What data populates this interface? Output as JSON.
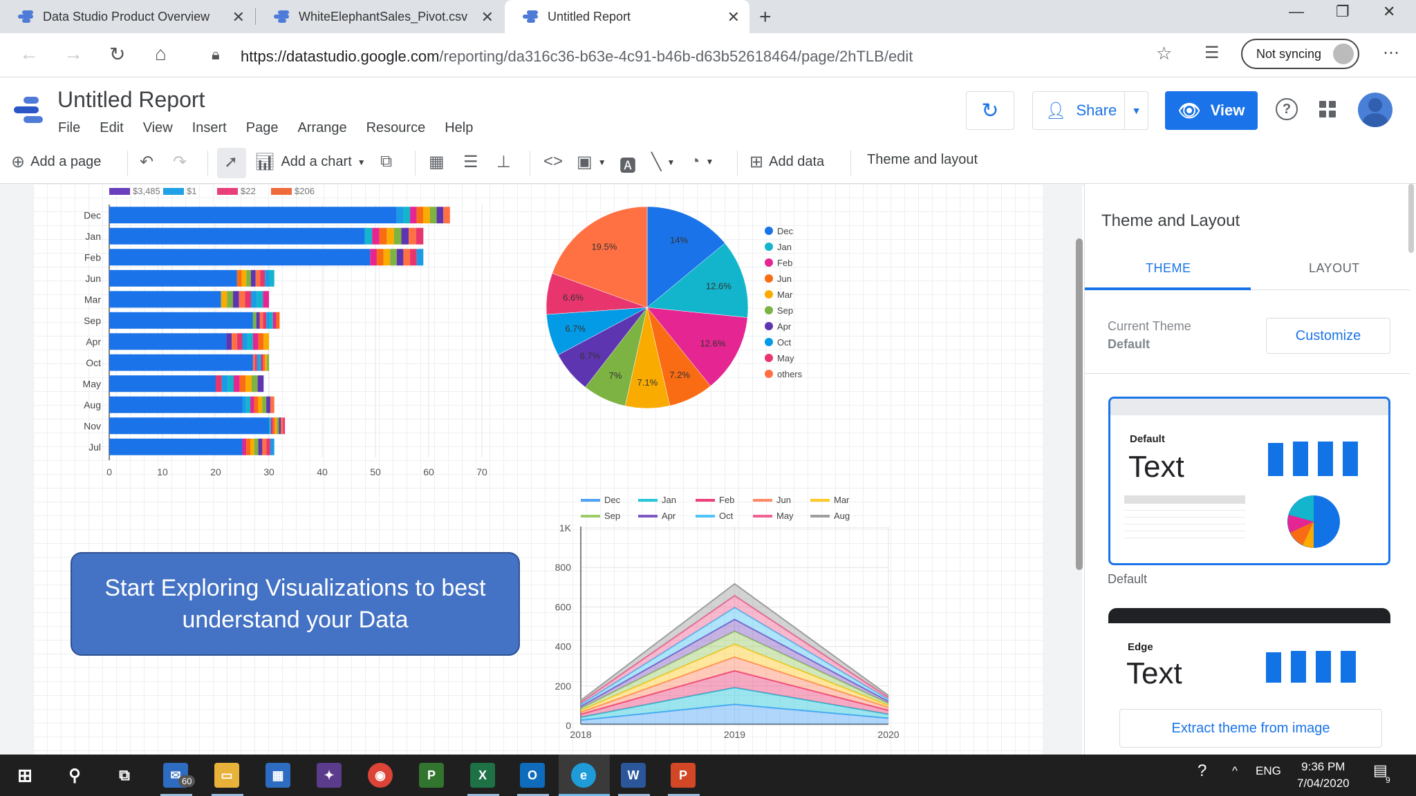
{
  "browser": {
    "tabs": [
      {
        "title": "Data Studio Product Overview",
        "active": false
      },
      {
        "title": "WhiteElephantSales_Pivot.csv",
        "active": false
      },
      {
        "title": "Untitled Report",
        "active": true
      }
    ],
    "url_host": "https://datastudio.google.com",
    "url_path": "/reporting/da316c36-b63e-4c91-b46b-d63b52618464/page/2hTLB/edit",
    "sync_label": "Not syncing"
  },
  "app": {
    "title": "Untitled Report",
    "menu": [
      "File",
      "Edit",
      "View",
      "Insert",
      "Page",
      "Arrange",
      "Resource",
      "Help"
    ],
    "share_label": "Share",
    "view_label": "View"
  },
  "toolbar": {
    "add_page": "Add a page",
    "add_chart": "Add a chart",
    "add_data": "Add data",
    "theme_layout": "Theme and layout"
  },
  "bar_chart": {
    "legend": [
      "$3,485",
      "$1",
      "$22",
      "$206"
    ],
    "legend_colors": [
      "#6a3fbd",
      "#1ea1e6",
      "#e8407a",
      "#f06b3c"
    ],
    "xticks": [
      "0",
      "10",
      "20",
      "30",
      "40",
      "50",
      "60",
      "70"
    ]
  },
  "pie_chart": {
    "legend": [
      "Dec",
      "Jan",
      "Feb",
      "Jun",
      "Mar",
      "Sep",
      "Apr",
      "Oct",
      "May",
      "others"
    ],
    "labels": [
      "14%",
      "12.6%",
      "12.6%",
      "7.2%",
      "7.1%",
      "7%",
      "6.7%",
      "6.7%",
      "6.6%",
      "19.5%"
    ]
  },
  "area_chart": {
    "legend": [
      "Dec",
      "Jan",
      "Feb",
      "Jun",
      "Mar",
      "Sep",
      "Apr",
      "Oct",
      "May",
      "Aug"
    ],
    "yticks": [
      "1K",
      "800",
      "600",
      "400",
      "200",
      "0"
    ],
    "xticks": [
      "2018",
      "2019",
      "2020"
    ]
  },
  "chart_data": [
    {
      "type": "bar",
      "orientation": "horizontal",
      "stacked": true,
      "categories": [
        "Dec",
        "Jan",
        "Feb",
        "Jun",
        "Mar",
        "Sep",
        "Apr",
        "Oct",
        "May",
        "Aug",
        "Nov",
        "Jul"
      ],
      "series": [
        {
          "values": [
            54,
            48,
            49,
            24,
            21,
            27,
            22,
            27,
            20,
            25,
            30,
            25
          ]
        }
      ],
      "totals": [
        64,
        59,
        59,
        31,
        30,
        32,
        30,
        30,
        29,
        31,
        33,
        31
      ],
      "xlim": [
        0,
        70
      ],
      "legend": [
        "$3,485",
        "$1",
        "$22",
        "$206"
      ]
    },
    {
      "type": "pie",
      "labels": [
        "Dec",
        "Jan",
        "Feb",
        "Jun",
        "Mar",
        "Sep",
        "Apr",
        "Oct",
        "May",
        "others"
      ],
      "values": [
        14,
        12.6,
        12.6,
        7.2,
        7.1,
        7,
        6.7,
        6.7,
        6.6,
        19.5
      ],
      "colors": [
        "#1a73e8",
        "#12b5cb",
        "#e52592",
        "#f96c13",
        "#f9ab00",
        "#7cb342",
        "#5e35b1",
        "#039be5",
        "#e8356e",
        "#ff7043"
      ]
    },
    {
      "type": "area",
      "stacked": true,
      "x": [
        "2018",
        "2019",
        "2020"
      ],
      "ylim": [
        0,
        1000
      ],
      "series": [
        {
          "name": "Dec",
          "values": [
            20,
            100,
            30
          ]
        },
        {
          "name": "Jan",
          "values": [
            15,
            85,
            20
          ]
        },
        {
          "name": "Feb",
          "values": [
            15,
            85,
            20
          ]
        },
        {
          "name": "Jun",
          "values": [
            10,
            70,
            15
          ]
        },
        {
          "name": "Mar",
          "values": [
            10,
            65,
            10
          ]
        },
        {
          "name": "Sep",
          "values": [
            10,
            65,
            10
          ]
        },
        {
          "name": "Apr",
          "values": [
            10,
            60,
            10
          ]
        },
        {
          "name": "Oct",
          "values": [
            10,
            60,
            10
          ]
        },
        {
          "name": "May",
          "values": [
            10,
            60,
            10
          ]
        },
        {
          "name": "Aug",
          "values": [
            10,
            60,
            10
          ]
        }
      ],
      "colors": [
        "#4fa3f7",
        "#26c6da",
        "#ec407a",
        "#ff8a65",
        "#ffca28",
        "#9ccc65",
        "#7e57c2",
        "#4fc3f7",
        "#f06292",
        "#9e9e9e"
      ]
    }
  ],
  "callout": {
    "text": "Start Exploring Visualizations to best understand your Data"
  },
  "panel": {
    "title": "Theme and Layout",
    "tab_theme": "THEME",
    "tab_layout": "LAYOUT",
    "current_theme_label": "Current Theme",
    "current_theme_value": "Default",
    "customize": "Customize",
    "default_card_name": "Default",
    "default_card_text": "Text",
    "default_label": "Default",
    "edge_card_name": "Edge",
    "edge_card_text": "Text",
    "extract": "Extract theme from image"
  },
  "taskbar": {
    "mail_badge": "60",
    "lang": "ENG",
    "time": "9:36 PM",
    "date": "7/04/2020",
    "notif_count": "9"
  }
}
